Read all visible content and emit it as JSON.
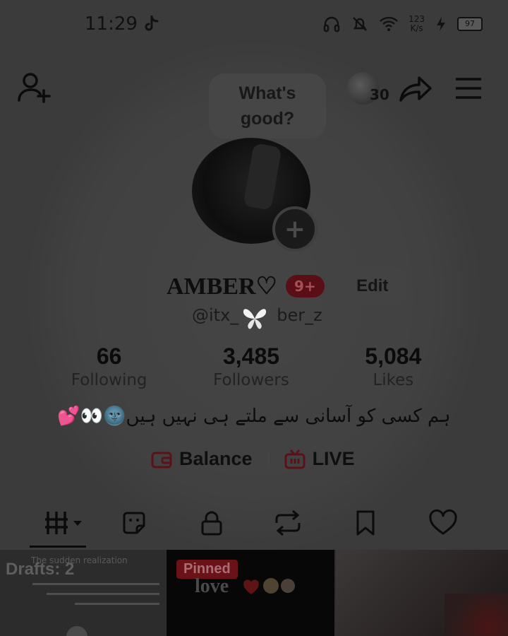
{
  "status_bar": {
    "time": "11:29",
    "net_speed_value": "123",
    "net_speed_unit": "K/s",
    "battery": "97"
  },
  "header": {
    "prompt_line1": "What's",
    "prompt_line2": "good?",
    "friends_count": "30"
  },
  "profile": {
    "display_name": "‪AMBER♡",
    "notification_badge": "9+",
    "edit_label": "Edit",
    "username_start": "@itx_",
    "username_end": "ber_z",
    "bio": "ہم کسی کو آسانی سے ملتے ہی نہیں ہیں🌚👀💕"
  },
  "stats": [
    {
      "value": "66",
      "label": "Following"
    },
    {
      "value": "3,485",
      "label": "Followers"
    },
    {
      "value": "5,084",
      "label": "Likes"
    }
  ],
  "links": {
    "balance": "Balance",
    "live": "LIVE"
  },
  "tabs": [
    "videos",
    "reposts-stickers",
    "private",
    "reposts",
    "saved",
    "liked"
  ],
  "grid": {
    "drafts_label": "Drafts: 2",
    "drafts_caption": "The sudden realization",
    "pinned_label": "Pinned",
    "pinned_text": "love"
  },
  "colors": {
    "accent_red": "#6a1218",
    "background": "#3b3b3b"
  }
}
